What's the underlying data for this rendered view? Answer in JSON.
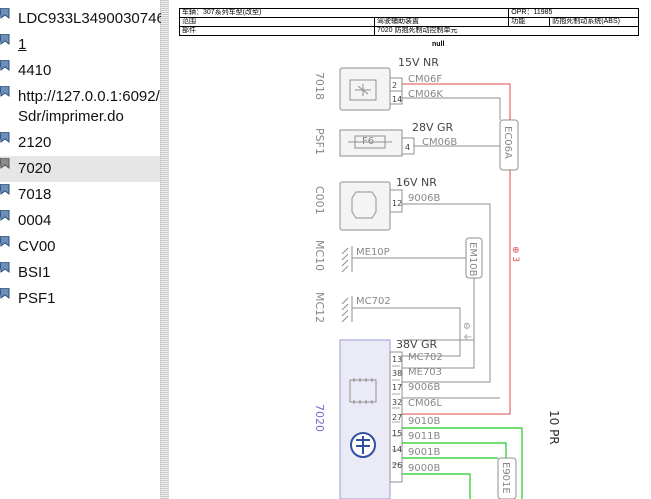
{
  "sidebar": {
    "items": [
      {
        "label": "LDC933L3490030746"
      },
      {
        "label": "1"
      },
      {
        "label": "4410"
      },
      {
        "label": "http://127.0.0.1:6092/"
      },
      {
        "label": "Sdr/imprimer.do"
      },
      {
        "label": "2120"
      },
      {
        "label": "7020"
      },
      {
        "label": "7018"
      },
      {
        "label": "0004"
      },
      {
        "label": "CV00"
      },
      {
        "label": "BSI1"
      },
      {
        "label": "PSF1"
      }
    ],
    "selected": "7020"
  },
  "document": {
    "header": {
      "vehicle": "车辆：307系列车型(改型)",
      "opr": "OPR：11985",
      "scope_label": "范围",
      "scope_value": "驾驶辅助装置",
      "function_label": "功能",
      "function_value": "防抱死制动系统(ABS)",
      "part_label": "部件",
      "part_value": "7020 防抱死制动控制单元"
    },
    "null_text": "null",
    "wiring": {
      "comp_7018": "7018",
      "comp_psf1": "PSF1",
      "comp_c001": "C001",
      "comp_mc10": "MC10",
      "comp_mc12": "MC12",
      "comp_7020": "7020",
      "conn_15v_nr_top": "15V NR",
      "conn_28v_gr": "28V GR",
      "conn_16v_nr": "16V NR",
      "conn_38v_gr": "38V GR",
      "fuse": "F6",
      "w_cm06f": "CM06F",
      "w_cm06k": "CM06K",
      "w_cm06b": "CM06B",
      "w_9006b_top": "9006B",
      "w_me10p": "ME10P",
      "w_mc702_top": "MC702",
      "w_mc702": "MC702",
      "w_me703": "ME703",
      "w_9006b": "9006B",
      "w_cm06l": "CM06L",
      "w_9010b": "9010B",
      "w_9011b": "9011B",
      "w_9001b": "9001B",
      "w_9000b": "9000B",
      "splice_ec06a": "EC06A",
      "splice_em10b": "EM10B",
      "splice_e901e": "E901E",
      "pin_2": "2",
      "pin_14": "14",
      "pin_4": "4",
      "pin_12": "12",
      "pin_13": "13",
      "pin_38": "38",
      "pin_17": "17",
      "pin_32": "32",
      "pin_27": "27",
      "pin_15": "15",
      "pin_14b": "14",
      "pin_26": "26",
      "red_mark": "⊕ 3",
      "gray_mark": "⊖ ⏚",
      "side_label": "10 PR"
    }
  },
  "colors": {
    "diagram_line": "#8f8f8f",
    "red_wire": "#e04a4a",
    "green_wire": "#22cc22",
    "purple_label": "#7a66c8",
    "ecu_fill": "#ebebf7"
  }
}
